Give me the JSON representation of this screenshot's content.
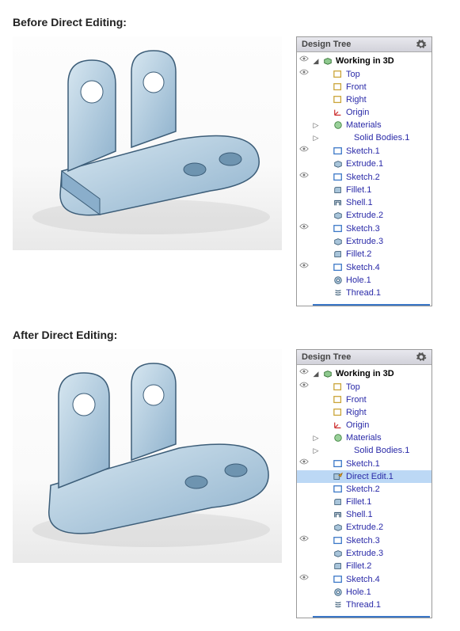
{
  "sections": {
    "before_label": "Before Direct Editing:",
    "after_label": "After Direct Editing:"
  },
  "panel": {
    "title": "Design Tree",
    "gear_icon": "gear-icon"
  },
  "tree_before": {
    "root": "Working in 3D",
    "nodes": [
      {
        "label": "Top",
        "icon": "plane",
        "indent": 1,
        "eye": true
      },
      {
        "label": "Front",
        "icon": "plane",
        "indent": 1,
        "eye": false
      },
      {
        "label": "Right",
        "icon": "plane",
        "indent": 1,
        "eye": false
      },
      {
        "label": "Origin",
        "icon": "origin",
        "indent": 1,
        "eye": false
      },
      {
        "label": "Materials",
        "icon": "materials",
        "indent": 1,
        "eye": false,
        "expander": "▷"
      },
      {
        "label": "Solid Bodies.1",
        "icon": "none",
        "indent": 2,
        "eye": false,
        "expander": "▷"
      },
      {
        "label": "Sketch.1",
        "icon": "sketch",
        "indent": 1,
        "eye": true
      },
      {
        "label": "Extrude.1",
        "icon": "extrude",
        "indent": 1,
        "eye": false
      },
      {
        "label": "Sketch.2",
        "icon": "sketch",
        "indent": 1,
        "eye": true
      },
      {
        "label": "Fillet.1",
        "icon": "fillet",
        "indent": 1,
        "eye": false
      },
      {
        "label": "Shell.1",
        "icon": "shell",
        "indent": 1,
        "eye": false
      },
      {
        "label": "Extrude.2",
        "icon": "extrude",
        "indent": 1,
        "eye": false
      },
      {
        "label": "Sketch.3",
        "icon": "sketch",
        "indent": 1,
        "eye": true
      },
      {
        "label": "Extrude.3",
        "icon": "extrude",
        "indent": 1,
        "eye": false
      },
      {
        "label": "Fillet.2",
        "icon": "fillet",
        "indent": 1,
        "eye": false
      },
      {
        "label": "Sketch.4",
        "icon": "sketch",
        "indent": 1,
        "eye": true
      },
      {
        "label": "Hole.1",
        "icon": "hole",
        "indent": 1,
        "eye": false
      },
      {
        "label": "Thread.1",
        "icon": "thread",
        "indent": 1,
        "eye": false
      }
    ]
  },
  "tree_after": {
    "root": "Working in 3D",
    "nodes": [
      {
        "label": "Top",
        "icon": "plane",
        "indent": 1,
        "eye": true
      },
      {
        "label": "Front",
        "icon": "plane",
        "indent": 1,
        "eye": false
      },
      {
        "label": "Right",
        "icon": "plane",
        "indent": 1,
        "eye": false
      },
      {
        "label": "Origin",
        "icon": "origin",
        "indent": 1,
        "eye": false
      },
      {
        "label": "Materials",
        "icon": "materials",
        "indent": 1,
        "eye": false,
        "expander": "▷"
      },
      {
        "label": "Solid Bodies.1",
        "icon": "none",
        "indent": 2,
        "eye": false,
        "expander": "▷"
      },
      {
        "label": "Sketch.1",
        "icon": "sketch",
        "indent": 1,
        "eye": true
      },
      {
        "label": "Direct Edit.1",
        "icon": "direct",
        "indent": 1,
        "eye": false,
        "selected": true
      },
      {
        "label": "Sketch.2",
        "icon": "sketch",
        "indent": 1,
        "eye": false
      },
      {
        "label": "Fillet.1",
        "icon": "fillet",
        "indent": 1,
        "eye": false
      },
      {
        "label": "Shell.1",
        "icon": "shell",
        "indent": 1,
        "eye": false
      },
      {
        "label": "Extrude.2",
        "icon": "extrude",
        "indent": 1,
        "eye": false
      },
      {
        "label": "Sketch.3",
        "icon": "sketch",
        "indent": 1,
        "eye": true
      },
      {
        "label": "Extrude.3",
        "icon": "extrude",
        "indent": 1,
        "eye": false
      },
      {
        "label": "Fillet.2",
        "icon": "fillet",
        "indent": 1,
        "eye": false
      },
      {
        "label": "Sketch.4",
        "icon": "sketch",
        "indent": 1,
        "eye": true
      },
      {
        "label": "Hole.1",
        "icon": "hole",
        "indent": 1,
        "eye": false
      },
      {
        "label": "Thread.1",
        "icon": "thread",
        "indent": 1,
        "eye": false
      }
    ]
  },
  "colors": {
    "part_fill": "#a9c5da",
    "part_edge": "#3c5d78",
    "selection": "#bcd8f5",
    "link_text": "#2a2aa8"
  }
}
